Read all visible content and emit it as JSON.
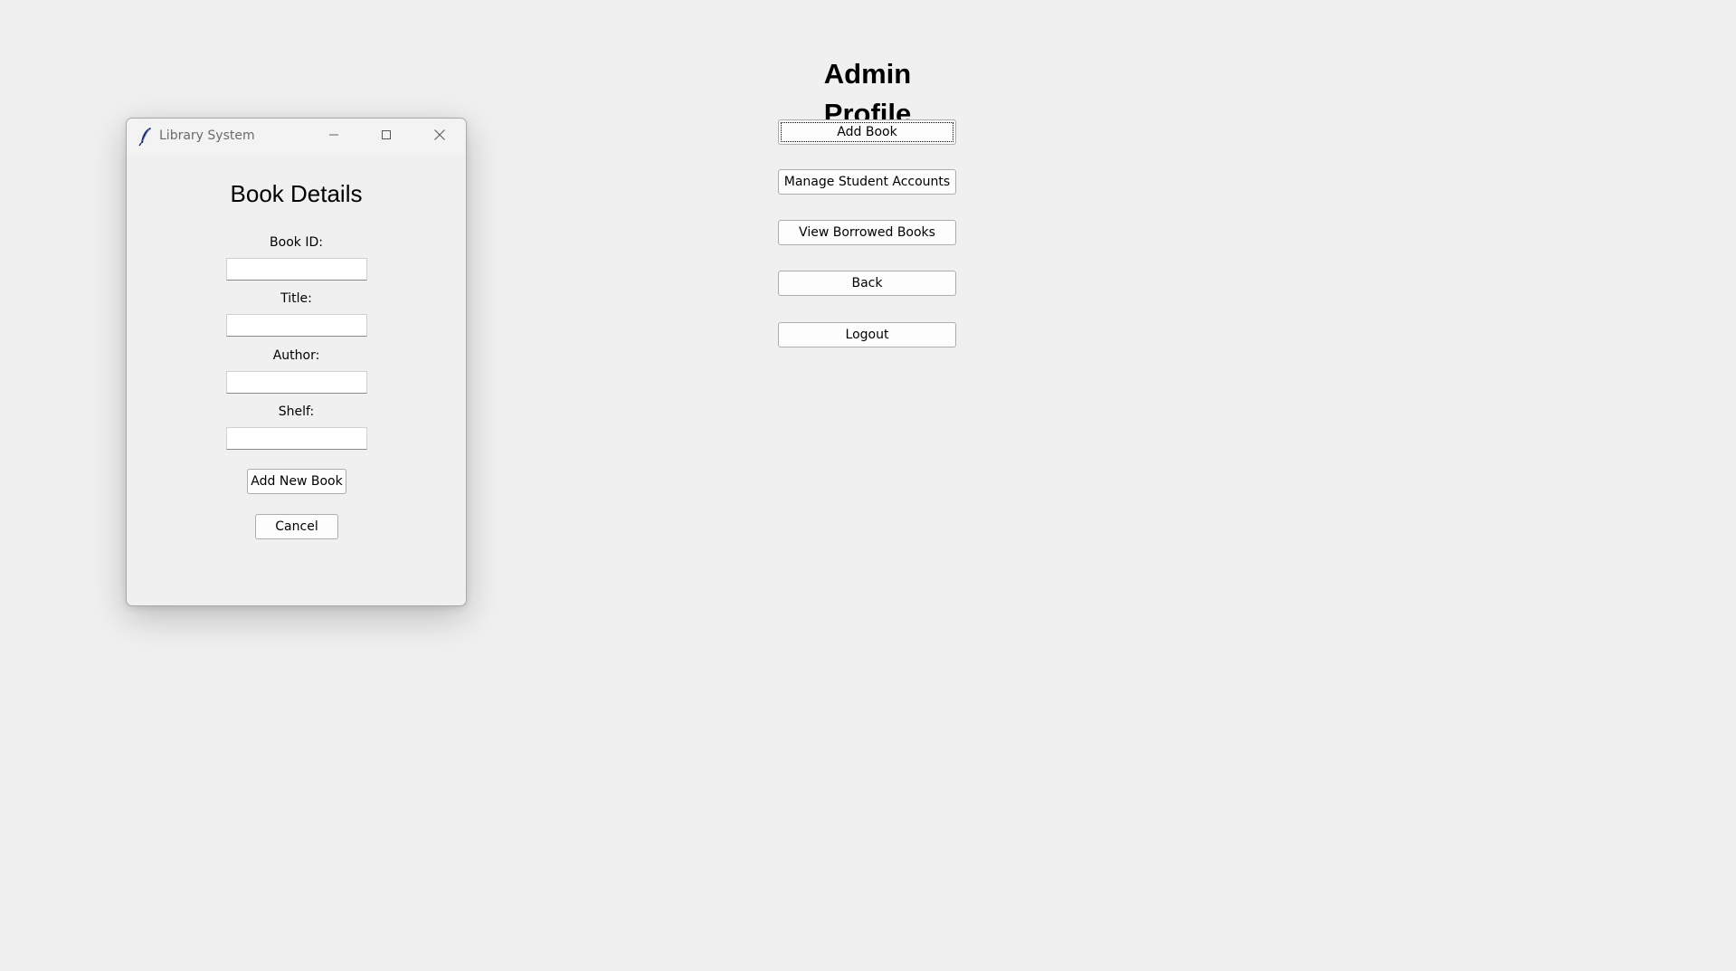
{
  "admin": {
    "title": "Admin Profile",
    "buttons": [
      {
        "label": "Add Book"
      },
      {
        "label": "Manage Student Accounts"
      },
      {
        "label": "View Borrowed Books"
      },
      {
        "label": "Back"
      },
      {
        "label": "Logout"
      }
    ]
  },
  "dialog": {
    "window_title": "Library System",
    "heading": "Book Details",
    "fields": [
      {
        "label": "Book ID:",
        "value": ""
      },
      {
        "label": "Title:",
        "value": ""
      },
      {
        "label": "Author:",
        "value": ""
      },
      {
        "label": "Shelf:",
        "value": ""
      }
    ],
    "add_button_label": "Add New Book",
    "cancel_button_label": "Cancel"
  },
  "icons": {
    "app_icon": "feather-icon",
    "minimize": "minimize-icon",
    "maximize": "maximize-icon",
    "close": "close-icon"
  },
  "colors": {
    "background": "#f0f0f0",
    "button_face": "#fdfdfd",
    "button_border": "#adadad",
    "titlebar_text": "#6b6b6b"
  }
}
